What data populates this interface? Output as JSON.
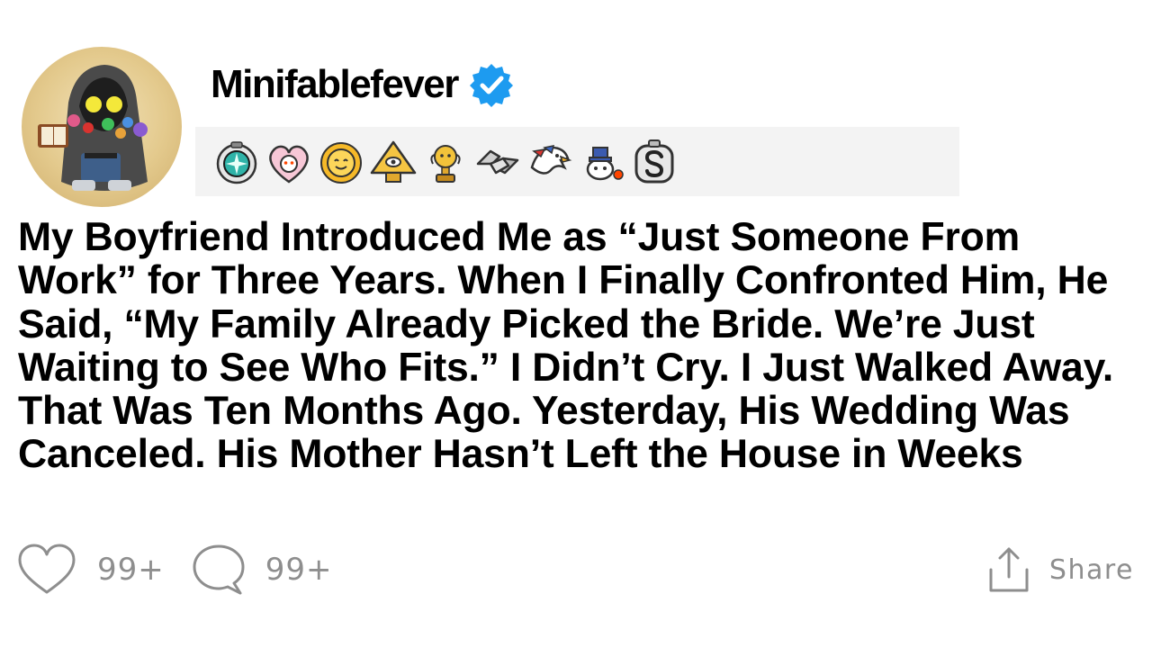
{
  "post": {
    "author": {
      "username": "Minifablefever",
      "verified": true,
      "avatar_icon": "hooded-figure-avatar-icon"
    },
    "badges": [
      "compass-badge-icon",
      "heart-snoo-badge-icon",
      "sun-badge-icon",
      "pyramid-eye-badge-icon",
      "gold-trophy-badge-icon",
      "handshake-badge-icon",
      "eagle-badge-icon",
      "snoo-hat-badge-icon",
      "letter-s-badge-icon"
    ],
    "title": "My Boyfriend Introduced Me as “Just Someone From Work” for Three Years. When I Finally Confronted Him, He Said, “My Family Already Picked the Bride. We’re Just Waiting to See Who Fits.” I Didn’t Cry. I Just Walked Away. That Was Ten Months Ago. Yesterday, His Wedding Was Canceled. His Mother Hasn’t Left the House in Weeks",
    "actions": {
      "likes": "99+",
      "comments": "99+",
      "share_label": "Share"
    }
  },
  "colors": {
    "verified_blue": "#1d9bf0",
    "badge_strip_bg": "#f3f3f3",
    "muted_gray": "#8e8e8e"
  }
}
